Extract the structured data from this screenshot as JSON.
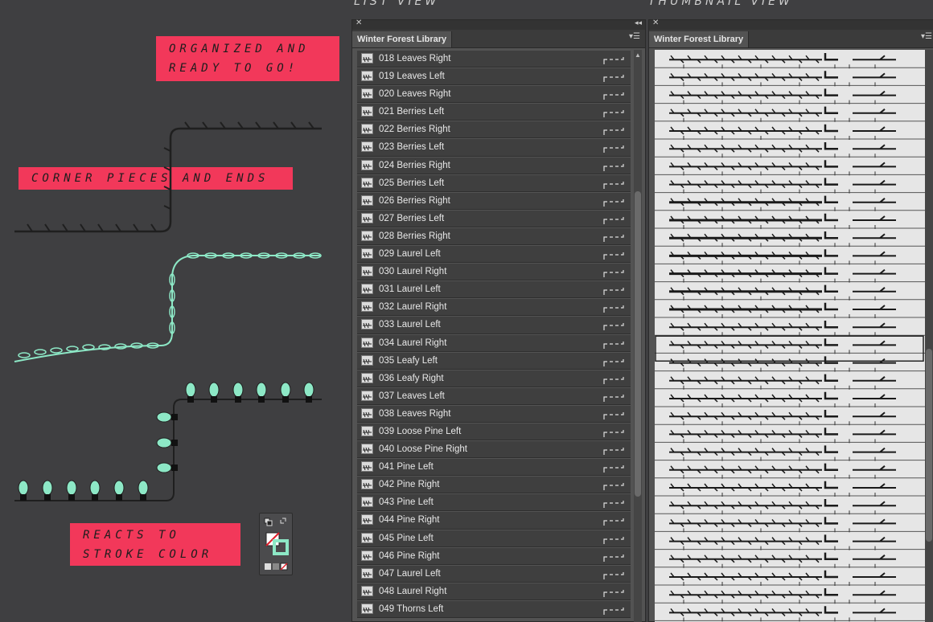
{
  "views": {
    "list_title": "LIST VIEW",
    "thumb_title": "THUMBNAIL VIEW"
  },
  "promo": {
    "organized": [
      "ORGANIZED AND",
      "READY TO GO!"
    ],
    "corner": "CORNER PIECES AND ENDS",
    "reacts": [
      "REACTS TO",
      "STROKE COLOR"
    ]
  },
  "colors": {
    "accent": "#f2385a",
    "mint": "#8de8c6",
    "panel": "#535353",
    "background": "#3f3f41"
  },
  "list_panel": {
    "tab": "Winter Forest Library",
    "items": [
      "018 Leaves Right",
      "019 Leaves Left",
      "020 Leaves Right",
      "021 Berries Left",
      "022 Berries Right",
      "023 Berries Left",
      "024 Berries Right",
      "025 Berries Left",
      "026 Berries Right",
      "027 Berries Left",
      "028 Berries Right",
      "029 Laurel Left",
      "030 Laurel Right",
      "031 Laurel Left",
      "032 Laurel Right",
      "033 Laurel Left",
      "034 Laurel Right",
      "035 Leafy Left",
      "036 Leafy Right",
      "037 Leaves Left",
      "038 Leaves Right",
      "039 Loose Pine Left",
      "040 Loose Pine Right",
      "041 Pine Left",
      "042 Pine Right",
      "043 Pine Left",
      "044 Pine Right",
      "045 Pine Left",
      "046 Pine Right",
      "047 Laurel Left",
      "048 Laurel Right",
      "049 Thorns Left"
    ]
  },
  "thumb_panel": {
    "tab": "Winter Forest Library",
    "selected_row": 16
  },
  "icons": {
    "close": "close-icon",
    "collapse": "collapse-arrows-icon",
    "menu": "panel-menu-icon",
    "brush_type": "pattern-brush-icon",
    "fill_stroke": "fill-stroke-swatch-icon"
  }
}
